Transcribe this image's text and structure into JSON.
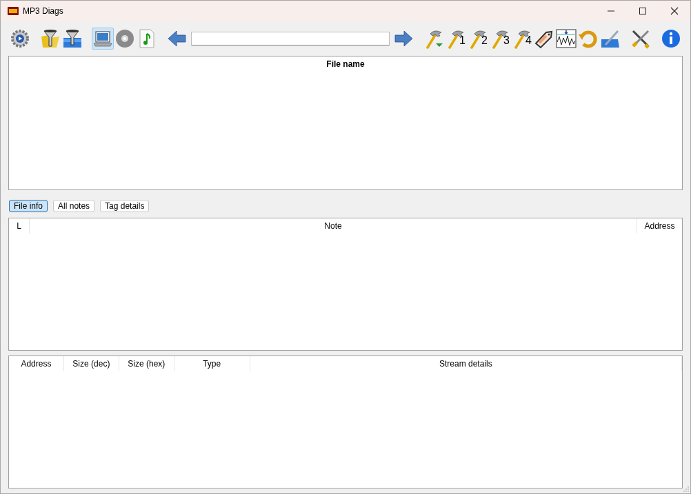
{
  "window": {
    "title": "MP3 Diags"
  },
  "toolbar": [
    {
      "kind": "gear"
    },
    {
      "kind": "spacer"
    },
    {
      "kind": "filteryellow"
    },
    {
      "kind": "filterblue"
    },
    {
      "kind": "spacer"
    },
    {
      "kind": "laptop",
      "selected": true
    },
    {
      "kind": "disc",
      "selected": false
    },
    {
      "kind": "note",
      "selected": false
    },
    {
      "kind": "spacer"
    },
    {
      "kind": "back"
    },
    {
      "kind": "path"
    },
    {
      "kind": "forward"
    },
    {
      "kind": "spacer"
    },
    {
      "kind": "hammerdown"
    },
    {
      "kind": "hammer",
      "label": "1"
    },
    {
      "kind": "hammer",
      "label": "2"
    },
    {
      "kind": "hammer",
      "label": "3"
    },
    {
      "kind": "hammer",
      "label": "4"
    },
    {
      "kind": "tag"
    },
    {
      "kind": "wave"
    },
    {
      "kind": "undo"
    },
    {
      "kind": "folderpen"
    },
    {
      "kind": "spacer"
    },
    {
      "kind": "tools"
    },
    {
      "kind": "spacer"
    },
    {
      "kind": "info"
    }
  ],
  "files_table": {
    "columns": [
      "File name"
    ]
  },
  "tabs": [
    {
      "label": "File info",
      "selected": true
    },
    {
      "label": "All notes",
      "selected": false
    },
    {
      "label": "Tag details",
      "selected": false
    }
  ],
  "notes_table": {
    "columns": [
      "L",
      "Note",
      "Address"
    ]
  },
  "streams_table": {
    "columns": [
      "Address",
      "Size (dec)",
      "Size (hex)",
      "Type",
      "Stream details"
    ]
  }
}
